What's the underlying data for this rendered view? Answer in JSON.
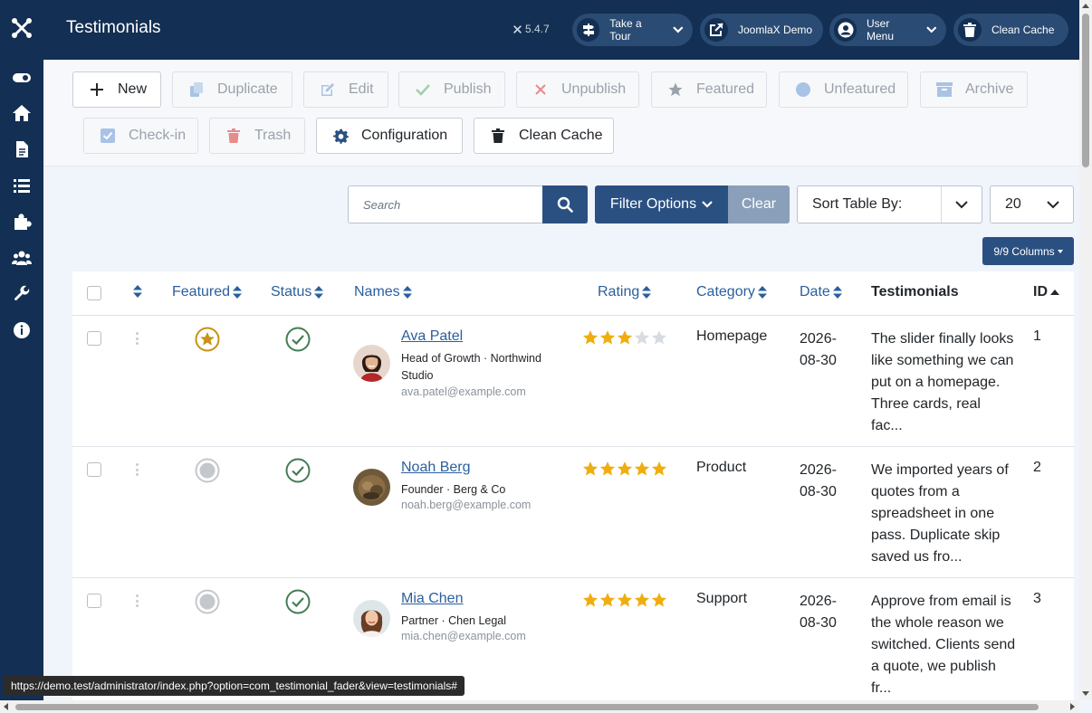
{
  "header": {
    "title": "Testimonials",
    "version": "5.4.7",
    "buttons": [
      {
        "label": "Take a Tour",
        "icon": "signpost-icon",
        "dropdown": true
      },
      {
        "label": "JoomlaX Demo",
        "icon": "external-link-icon",
        "dropdown": false
      },
      {
        "label": "User Menu",
        "icon": "user-icon",
        "dropdown": true
      },
      {
        "label": "Clean Cache",
        "icon": "trash-icon",
        "dropdown": false
      }
    ]
  },
  "sidebar": {
    "items": [
      "toggle-menu-icon",
      "home-icon",
      "content-icon",
      "menus-icon",
      "components-icon",
      "users-icon",
      "system-icon",
      "help-icon"
    ]
  },
  "toolbar": {
    "new": "New",
    "duplicate": "Duplicate",
    "edit": "Edit",
    "publish": "Publish",
    "unpublish": "Unpublish",
    "featured": "Featured",
    "unfeatured": "Unfeatured",
    "archive": "Archive",
    "checkin": "Check-in",
    "trash": "Trash",
    "configuration": "Configuration",
    "clean_cache": "Clean Cache"
  },
  "filters": {
    "search_placeholder": "Search",
    "filter_options": "Filter Options",
    "clear": "Clear",
    "sort_by": "Sort Table By:",
    "limit": "20",
    "columns": "9/9 Columns"
  },
  "table": {
    "headers": {
      "featured": "Featured",
      "status": "Status",
      "names": "Names",
      "rating": "Rating",
      "category": "Category",
      "date": "Date",
      "testimonials": "Testimonials",
      "id": "ID"
    },
    "rows": [
      {
        "featured": true,
        "published": true,
        "name": "Ava Patel",
        "role": "Head of Growth · Northwind Studio",
        "email": "ava.patel@example.com",
        "rating": 3,
        "category": "Homepage",
        "date": "2026-08-30",
        "testimonial": "The slider finally looks like something we can put on a homepage. Three cards, real fac...",
        "id": "1"
      },
      {
        "featured": false,
        "published": true,
        "name": "Noah Berg",
        "role": "Founder · Berg & Co",
        "email": "noah.berg@example.com",
        "rating": 5,
        "category": "Product",
        "date": "2026-08-30",
        "testimonial": "We imported years of quotes from a spreadsheet in one pass. Duplicate skip saved us fro...",
        "id": "2"
      },
      {
        "featured": false,
        "published": true,
        "name": "Mia Chen",
        "role": "Partner · Chen Legal",
        "email": "mia.chen@example.com",
        "rating": 5,
        "category": "Support",
        "date": "2026-08-30",
        "testimonial": "Approve from email is the whole reason we switched. Clients send a quote, we publish fr...",
        "id": "3"
      }
    ]
  },
  "status_bar": {
    "url": "https://demo.test/administrator/index.php?option=com_testimonial_fader&view=testimonials#"
  },
  "colors": {
    "navy": "#132f53",
    "primary": "#2a5082",
    "link": "#2a5f9e",
    "star": "#f0ad0e",
    "success": "#457d54",
    "featured": "#c79313"
  }
}
